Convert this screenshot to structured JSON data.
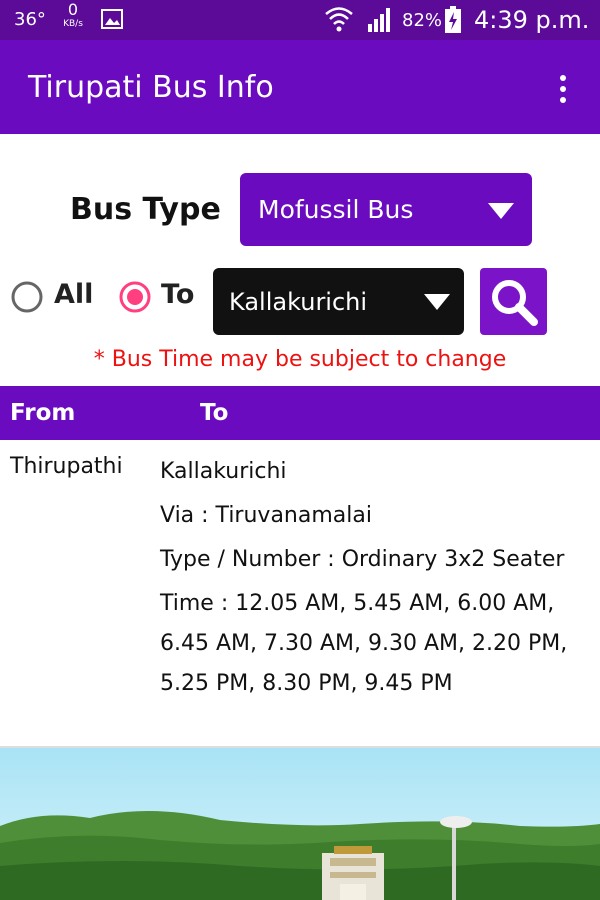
{
  "status_bar": {
    "temperature": "36°",
    "data_speed": "0",
    "data_unit": "KB/s",
    "battery": "82%",
    "time": "4:39 p.m."
  },
  "app_bar": {
    "title": "Tirupati Bus Info",
    "menu_icon": "more-vert-icon"
  },
  "filters": {
    "bus_type_label": "Bus Type",
    "bus_type_value": "Mofussil Bus",
    "radio_all_label": "All",
    "radio_to_label": "To",
    "selected_radio": "To",
    "destination_value": "Kallakurichi",
    "search_icon": "search-icon"
  },
  "notice": "* Bus Time may be subject to change",
  "table": {
    "headers": [
      "From",
      "To"
    ],
    "rows": [
      {
        "from": "Thirupathi",
        "to": "Kallakurichi",
        "via": "Via : Tiruvanamalai",
        "type": "Type / Number :  Ordinary 3x2 Seater",
        "time": "Time : 12.05 AM,  5.45 AM,  6.00 AM,  6.45 AM,  7.30 AM,  9.30 AM,  2.20 PM,  5.25 PM,  8.30 PM,  9.45 PM"
      }
    ]
  },
  "colors": {
    "status_bar": "#5b0b98",
    "primary": "#6a0bc0",
    "notice": "#e11111",
    "radio_selected": "#ff3f7f"
  }
}
